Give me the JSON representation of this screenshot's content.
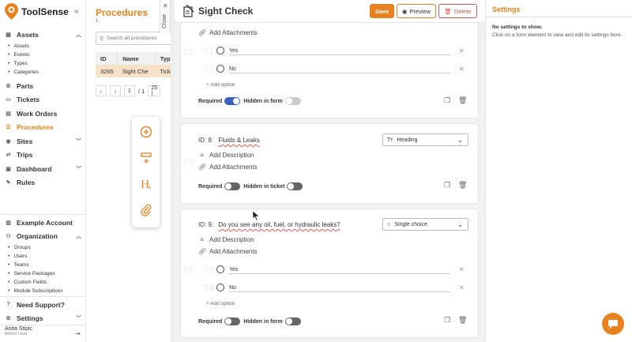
{
  "app": {
    "name": "ToolSense",
    "collapse_icon": "double-chevron-left-icon"
  },
  "sidebar": {
    "main": [
      {
        "label": "Assets",
        "icon": "grid-icon",
        "expanded": true
      },
      {
        "label": "Parts",
        "icon": "parts-icon"
      },
      {
        "label": "Tickets",
        "icon": "ticket-icon"
      },
      {
        "label": "Work Orders",
        "icon": "clipboard-icon"
      },
      {
        "label": "Procedures",
        "icon": "list-icon",
        "active": true
      },
      {
        "label": "Sites",
        "icon": "pin-icon",
        "expanded": false
      },
      {
        "label": "Trips",
        "icon": "route-icon"
      },
      {
        "label": "Dashboard",
        "icon": "dashboard-icon",
        "expanded": false
      },
      {
        "label": "Rules",
        "icon": "rules-icon"
      }
    ],
    "assets_sub": [
      "Assets",
      "Events",
      "Types",
      "Categories"
    ],
    "account": "Example Account",
    "organization": "Organization",
    "org_sub": [
      "Groups",
      "Users",
      "Teams",
      "Service Packages",
      "Custom Fields",
      "Module Subscriptions"
    ],
    "support": "Need Support?",
    "settings": "Settings",
    "user": {
      "name": "Anita Stipic",
      "role": "Admin User"
    }
  },
  "procedures": {
    "title": "Procedures",
    "count": "1",
    "search_placeholder": "Search all procedures",
    "columns": [
      "ID",
      "Name",
      "Typ"
    ],
    "rows": [
      {
        "id": "3265",
        "name": "Sight Che",
        "type": "Tick"
      }
    ],
    "pager": {
      "page": "1",
      "total": "/ 1",
      "size": "25 |"
    }
  },
  "close_label": "Close",
  "editor": {
    "title": "Sight Check",
    "save": "Save",
    "preview": "Preview",
    "delete": "Delete",
    "card1": {
      "add_attachments": "Add Attachments",
      "options": [
        "Yes",
        "No"
      ],
      "add_option": "+ Add option",
      "required": "Required",
      "hidden": "Hidden in form"
    },
    "card2": {
      "id": "ID: 8.",
      "title": "Fluids & Leaks",
      "type": "Heading",
      "add_description": "Add Description",
      "add_attachments": "Add Attachments",
      "required": "Required",
      "hidden": "Hidden in ticket"
    },
    "card3": {
      "id": "ID: 9.",
      "title": "Do you see any oil, fuel, or hydraulic leaks?",
      "type": "Single choice",
      "add_description": "Add Description",
      "add_attachments": "Add Attachments",
      "options": [
        "Yes",
        "No"
      ],
      "add_option": "+ Add option",
      "required": "Required",
      "hidden": "Hidden in form"
    }
  },
  "settings_panel": {
    "title": "Settings",
    "empty": "No settings to show.",
    "hint": "Click on a form element to view and edit its settings here."
  },
  "colors": {
    "accent": "#e8821e",
    "toggle_on": "#3a5fbf",
    "danger": "#d9534f"
  }
}
